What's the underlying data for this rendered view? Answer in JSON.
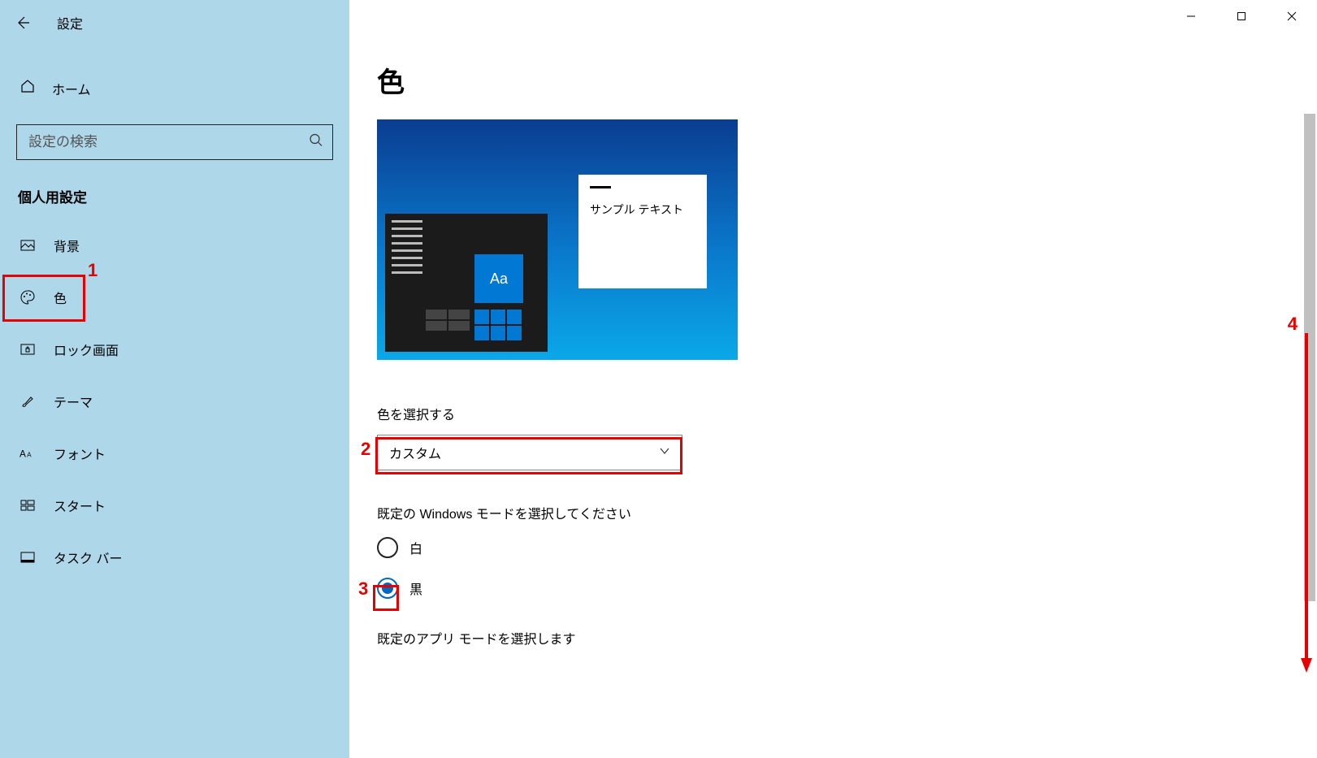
{
  "window": {
    "title": "設定"
  },
  "sidebar": {
    "home": "ホーム",
    "search_placeholder": "設定の検索",
    "section": "個人用設定",
    "items": [
      {
        "label": "背景"
      },
      {
        "label": "色"
      },
      {
        "label": "ロック画面"
      },
      {
        "label": "テーマ"
      },
      {
        "label": "フォント"
      },
      {
        "label": "スタート"
      },
      {
        "label": "タスク バー"
      }
    ]
  },
  "page": {
    "title": "色",
    "preview_sample_text": "サンプル テキスト",
    "preview_tile_text": "Aa",
    "choose_color_label": "色を選択する",
    "choose_color_value": "カスタム",
    "windows_mode_label": "既定の Windows モードを選択してください",
    "windows_mode_options": {
      "light": "白",
      "dark": "黒"
    },
    "windows_mode_selected": "dark",
    "app_mode_label": "既定のアプリ モードを選択します"
  },
  "annotations": {
    "n1": "1",
    "n2": "2",
    "n3": "3",
    "n4": "4"
  }
}
